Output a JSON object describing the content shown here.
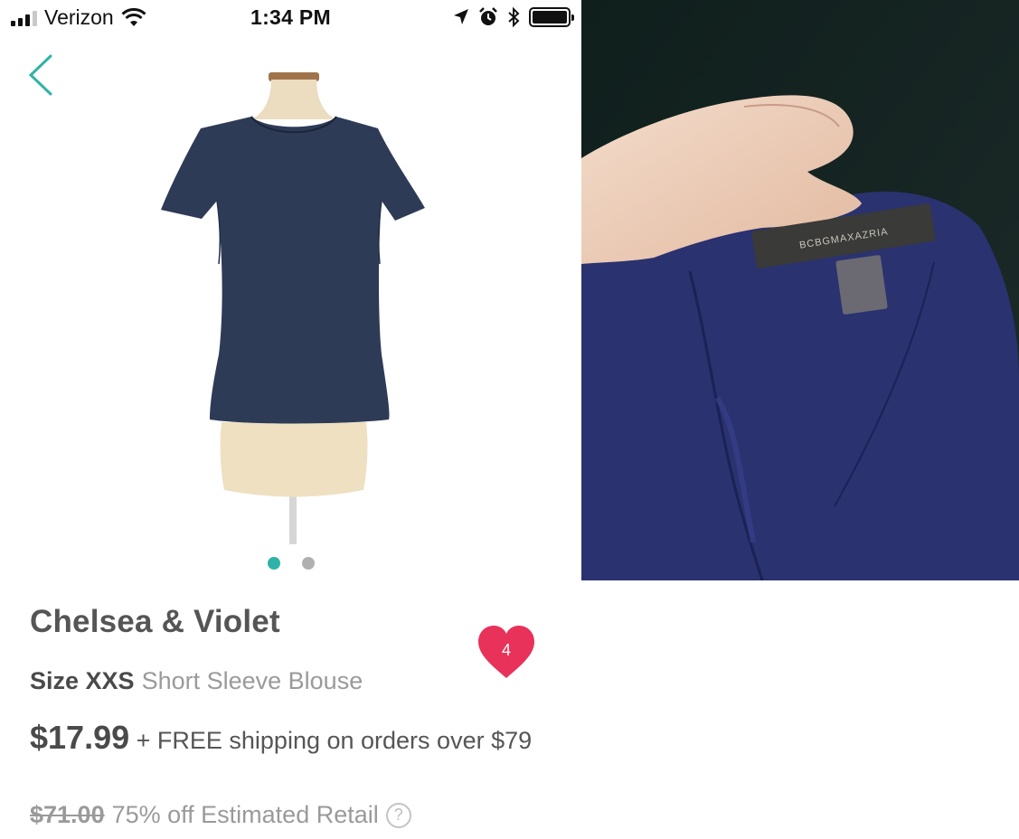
{
  "colors": {
    "accent": "#2fb3a8",
    "heart": "#e8325a",
    "dot_inactive": "#b0b0b0",
    "fabric": "#2e3b56",
    "label_photo_fabric": "#2a3270"
  },
  "status_bar": {
    "carrier": "Verizon",
    "time": "1:34 PM",
    "icons": [
      "signal-icon",
      "wifi-icon",
      "location-icon",
      "alarm-icon",
      "bluetooth-icon",
      "battery-icon"
    ]
  },
  "nav": {
    "back_icon": "chevron-left-icon"
  },
  "gallery": {
    "image_count": 2,
    "active_index": 0
  },
  "product": {
    "brand": "Chelsea & Violet",
    "size": "Size XXS",
    "category": "Short Sleeve Blouse",
    "price": "$17.99",
    "shipping": "+ FREE shipping on orders over $79",
    "retail_price": "$71.00",
    "discount": "75% off Estimated Retail",
    "help_glyph": "?",
    "favorites": "4"
  },
  "label_photo": {
    "tag_text": "BCBGMAXAZRIA"
  }
}
